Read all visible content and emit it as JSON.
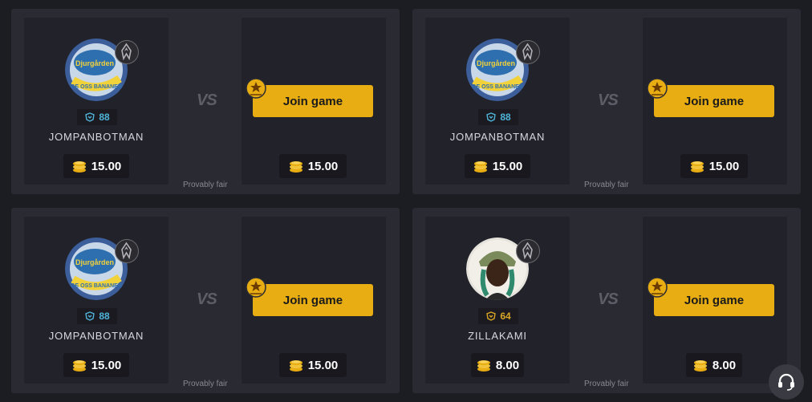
{
  "games": [
    {
      "username": "JOMPANBOTMAN",
      "level": "88",
      "level_color": "#4fb4d8",
      "avatar": "djurgarden-snus-avatar",
      "bet": "15.00",
      "opponent_bet": "15.00",
      "vs": "VS",
      "join_label": "Join game",
      "fair_label": "Provably fair"
    },
    {
      "username": "JOMPANBOTMAN",
      "level": "88",
      "level_color": "#4fb4d8",
      "avatar": "djurgarden-snus-avatar",
      "bet": "15.00",
      "opponent_bet": "15.00",
      "vs": "VS",
      "join_label": "Join game",
      "fair_label": "Provably fair"
    },
    {
      "username": "JOMPANBOTMAN",
      "level": "88",
      "level_color": "#4fb4d8",
      "avatar": "djurgarden-snus-avatar",
      "bet": "15.00",
      "opponent_bet": "15.00",
      "vs": "VS",
      "join_label": "Join game",
      "fair_label": "Provably fair"
    },
    {
      "username": "ZILLAKAMI",
      "level": "64",
      "level_color": "#d9a527",
      "avatar": "person-photo-avatar",
      "bet": "8.00",
      "opponent_bet": "8.00",
      "vs": "VS",
      "join_label": "Join game",
      "fair_label": "Provably fair"
    }
  ],
  "colors": {
    "accent": "#e8ad12",
    "card": "#2a2a33",
    "panel": "#22222a",
    "background": "#1c1c23"
  },
  "support_icon": "headset-icon"
}
